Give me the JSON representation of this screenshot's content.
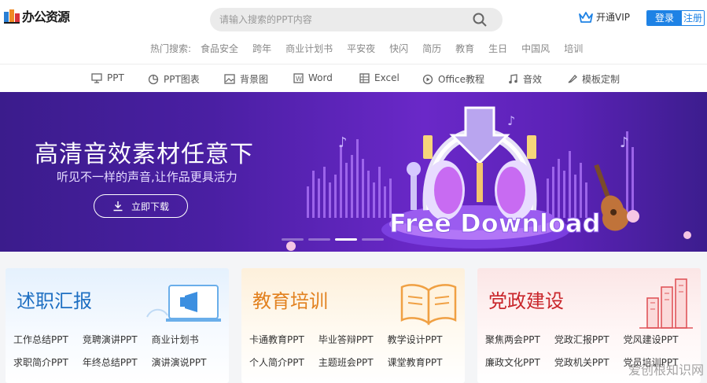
{
  "header": {
    "logo_text": "办公资源",
    "search_placeholder": "请输入搜索的PPT内容",
    "vip_label": "开通VIP",
    "login_label": "登录",
    "register_label": "注册",
    "hot_label": "热门搜索:",
    "hot_items": [
      "食品安全",
      "跨年",
      "商业计划书",
      "平安夜",
      "快闪",
      "简历",
      "教育",
      "生日",
      "中国风",
      "培训"
    ]
  },
  "nav": {
    "items": [
      {
        "label": "PPT",
        "icon": "monitor-icon"
      },
      {
        "label": "PPT图表",
        "icon": "pie-chart-icon"
      },
      {
        "label": "背景图",
        "icon": "image-icon"
      },
      {
        "label": "Word",
        "icon": "word-icon"
      },
      {
        "label": "Excel",
        "icon": "excel-icon"
      },
      {
        "label": "Office教程",
        "icon": "play-icon"
      },
      {
        "label": "音效",
        "icon": "music-icon"
      },
      {
        "label": "模板定制",
        "icon": "brush-icon"
      }
    ]
  },
  "banner": {
    "title": "高清音效素材任意下",
    "subtitle": "听见不一样的声音,让作品更具活力",
    "button_label": "立即下载",
    "art_text": "Free Download",
    "slides": 4,
    "active_slide": 2
  },
  "cards": [
    {
      "title": "述职汇报",
      "color": "#1e6fc2",
      "links": [
        [
          "工作总结PPT",
          "竞聘演讲PPT",
          "商业计划书"
        ],
        [
          "求职简介PPT",
          "年终总结PPT",
          "演讲演说PPT"
        ]
      ]
    },
    {
      "title": "教育培训",
      "color": "#e2811f",
      "links": [
        [
          "卡通教育PPT",
          "毕业答辩PPT",
          "教学设计PPT"
        ],
        [
          "个人简介PPT",
          "主题班会PPT",
          "课堂教育PPT"
        ]
      ]
    },
    {
      "title": "党政建设",
      "color": "#c9262b",
      "links": [
        [
          "聚焦两会PPT",
          "党政汇报PPT",
          "党风建设PPT"
        ],
        [
          "廉政文化PPT",
          "党政机关PPT",
          "党员培训PPT"
        ]
      ]
    }
  ],
  "watermark": "爱创根知识网",
  "colors": {
    "accent": "#1e82e5",
    "banner_bg": "#4a1fa3"
  }
}
